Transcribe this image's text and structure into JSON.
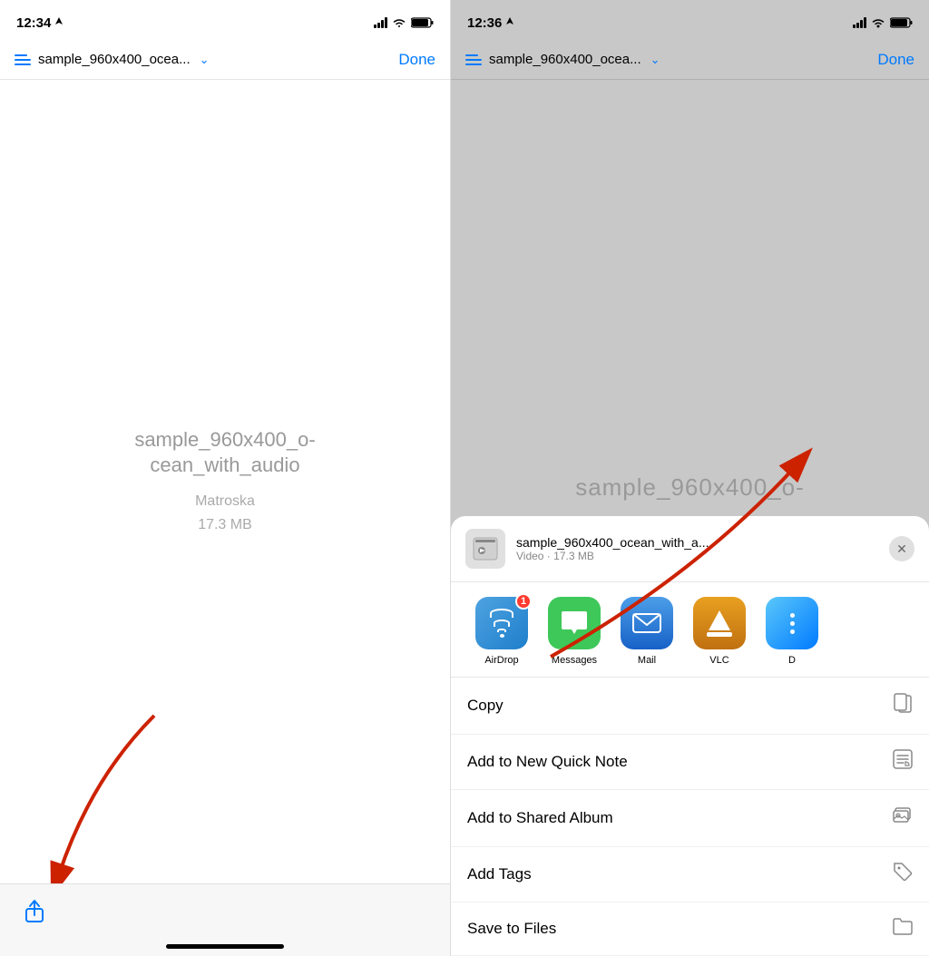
{
  "left_phone": {
    "status_time": "12:34",
    "nav_title": "sample_960x400_ocea...",
    "done_label": "Done",
    "file_name_line1": "sample_960x400_o-",
    "file_name_line2": "cean_with_audio",
    "file_type": "Matroska",
    "file_size": "17.3 MB"
  },
  "right_phone": {
    "status_time": "12:36",
    "nav_title": "sample_960x400_ocea...",
    "done_label": "Done",
    "video_label": "sample_960x400_o-",
    "share_file_name": "sample_960x400_ocean_with_a...",
    "share_file_meta": "Video · 17.3 MB",
    "apps": [
      {
        "name": "AirDrop",
        "type": "airdrop",
        "badge": "1"
      },
      {
        "name": "Messages",
        "type": "messages",
        "badge": null
      },
      {
        "name": "Mail",
        "type": "mail",
        "badge": null
      },
      {
        "name": "VLC",
        "type": "vlc",
        "badge": null
      },
      {
        "name": "D",
        "type": "more",
        "badge": null
      }
    ],
    "actions": [
      {
        "label": "Copy",
        "icon": "📋"
      },
      {
        "label": "Add to New Quick Note",
        "icon": "📝"
      },
      {
        "label": "Add to Shared Album",
        "icon": "🖼"
      },
      {
        "label": "Add Tags",
        "icon": "🏷"
      },
      {
        "label": "Save to Files",
        "icon": "📁"
      }
    ]
  }
}
